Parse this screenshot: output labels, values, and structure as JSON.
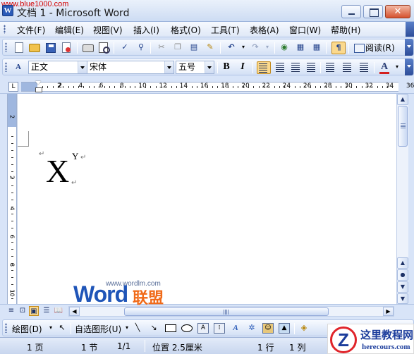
{
  "window": {
    "title": "文档 1 - Microsoft Word",
    "watermark_url": "www.blue1000.com",
    "close_glyph": "✕",
    "app_icon_letter": "W"
  },
  "menu": [
    "文件(F)",
    "编辑(E)",
    "视图(V)",
    "插入(I)",
    "格式(O)",
    "工具(T)",
    "表格(A)",
    "窗口(W)",
    "帮助(H)"
  ],
  "standard_toolbar": {
    "read_label": "阅读(R)",
    "icons": [
      "new-document-icon",
      "open-folder-icon",
      "save-icon",
      "permission-icon",
      "print-icon",
      "print-preview-icon",
      "spelling-icon",
      "research-icon",
      "cut-icon",
      "copy-icon",
      "paste-icon",
      "format-painter-icon",
      "undo-icon",
      "redo-icon",
      "hyperlink-icon",
      "tables-borders-icon",
      "insert-table-icon",
      "show-hide-icon"
    ]
  },
  "formatting_toolbar": {
    "style": "正文",
    "font": "宋体",
    "size": "五号",
    "bold_label": "B",
    "italic_label": "I",
    "font_color_label": "A",
    "styles_icon_label": "A",
    "active_alignment": "justify"
  },
  "ruler": {
    "tab_selector": "L",
    "horizontal_ticks": [
      "2",
      "2",
      "4",
      "6",
      "8",
      "10",
      "12",
      "14",
      "16",
      "18",
      "20",
      "22",
      "24",
      "26",
      "28",
      "30",
      "32",
      "34",
      "36"
    ],
    "vertical_ticks": [
      "2",
      "2",
      "4",
      "6",
      "8",
      "10"
    ]
  },
  "document": {
    "base_text": "X",
    "superscript_text": "Y",
    "paragraph_mark": "↵"
  },
  "view_bar": {
    "active_view": "print-layout",
    "views": [
      "normal-view-icon",
      "web-layout-icon",
      "print-layout-icon",
      "outline-view-icon",
      "reading-layout-icon"
    ]
  },
  "drawing_toolbar": {
    "draw_menu": "绘图(D)",
    "autoshapes_menu": "自选图形(U)"
  },
  "status_bar": {
    "page": "1 页",
    "section": "1 节",
    "page_of": "1/1",
    "position": "位置 2.5厘米",
    "line": "1 行",
    "column": "1 列"
  },
  "overlays": {
    "logo_word": "Word",
    "logo_cn": "联盟",
    "logo_url": "www.wordlm.com",
    "corner_title": "这里教程网",
    "corner_url": "herecours.com",
    "corner_mark": "Z"
  },
  "colors": {
    "font_color_swatch": "#d42020",
    "active_button": "#fbd98d",
    "logo_blue": "#1f55b8",
    "logo_orange": "#f06a18"
  }
}
